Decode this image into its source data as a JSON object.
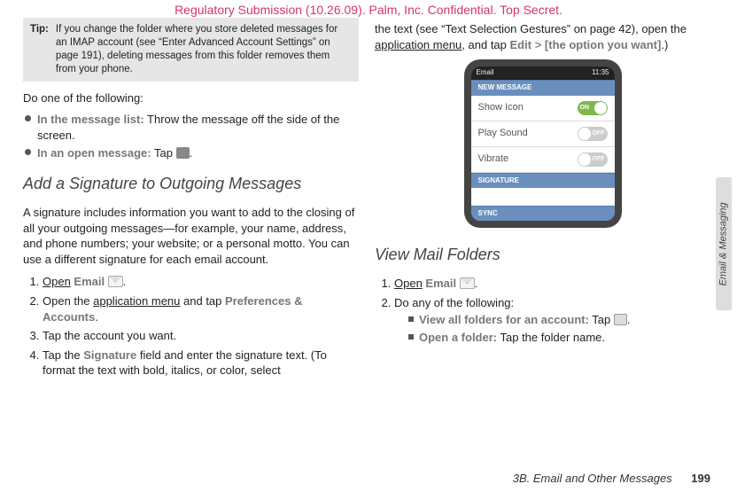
{
  "header": "Regulatory Submission (10.26.09). Palm, Inc. Confidential. Top Secret.",
  "tip": {
    "label": "Tip:",
    "body": "If you change the folder where you store deleted messages for an IMAP account (see “Enter Advanced Account Settings” on page 191), deleting messages from this folder removes them from your phone."
  },
  "left": {
    "do_one": "Do one of the following:",
    "bullets": [
      {
        "lead": "In the message list:",
        "rest": " Throw the message off the side of the screen."
      },
      {
        "lead": "In an open message:",
        "rest": " Tap "
      }
    ],
    "h2": "Add a Signature to Outgoing Messages",
    "intro": "A signature includes information you want to add to the closing of all your outgoing messages—for example, your name, address, and phone numbers; your website; or a personal motto. You can use a different signature for each email account.",
    "steps": {
      "s1_open": "Open",
      "s1_email": " Email ",
      "s2_a": "Open the ",
      "s2_am": "application menu",
      "s2_b": " and tap ",
      "s2_pa": "Preferences & Accounts",
      "s3": "Tap the account you want.",
      "s4_a": "Tap the ",
      "s4_sig": "Signature",
      "s4_b": " field and enter the signature text. (To format the text with bold, italics, or color, select"
    }
  },
  "right": {
    "top_a": "the text (see “Text Selection Gestures” on page 42), open the ",
    "top_am": "application menu",
    "top_b": ", and tap ",
    "top_edit": "Edit",
    "top_chev": " > ",
    "top_opt": "[the option you want]",
    "top_end": ".)",
    "h2": "View Mail Folders",
    "s1_open": "Open",
    "s1_email": " Email ",
    "s2": "Do any of the following:",
    "sub": [
      {
        "lead": "View all folders for an account:",
        "rest": " Tap "
      },
      {
        "lead": "Open a folder:",
        "rest": " Tap the folder name."
      }
    ]
  },
  "phone": {
    "status_left": "Email",
    "status_right": "11:35",
    "sec1": "NEW MESSAGE",
    "rows": [
      {
        "label": "Show Icon",
        "state": "on",
        "text": "ON"
      },
      {
        "label": "Play Sound",
        "state": "off",
        "text": "OFF"
      },
      {
        "label": "Vibrate",
        "state": "off",
        "text": "OFF"
      }
    ],
    "sec2": "SIGNATURE",
    "sec3": "SYNC"
  },
  "side_tab": "Email & Messaging",
  "footer": {
    "title": "3B. Email and Other Messages",
    "page": "199"
  }
}
